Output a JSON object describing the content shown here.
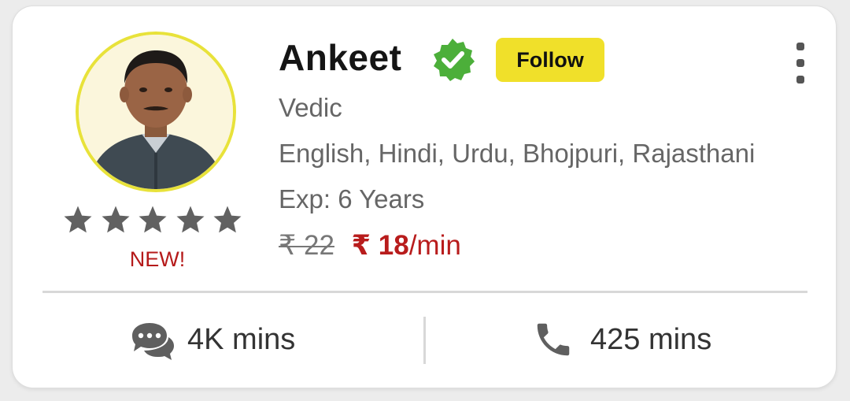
{
  "profile": {
    "name": "Ankeet",
    "follow_label": "Follow",
    "skill": "Vedic",
    "languages": "English, Hindi, Urdu, Bhojpuri, Rajasthani",
    "experience": "Exp: 6 Years",
    "badge": "NEW!",
    "rating_stars": 5
  },
  "pricing": {
    "original": "₹ 22",
    "current": "₹ 18",
    "unit": "/min"
  },
  "stats": {
    "chat_minutes": "4K mins",
    "call_minutes": "425 mins"
  },
  "icons": {
    "verified": "verified-badge-icon",
    "more": "kebab-menu-icon",
    "chat": "chat-bubbles-icon",
    "call": "phone-icon",
    "star": "star-icon"
  },
  "colors": {
    "accent_yellow": "#f0e02a",
    "verified_green": "#4caf3a",
    "price_red": "#b81c1c",
    "star_gray": "#616161"
  }
}
